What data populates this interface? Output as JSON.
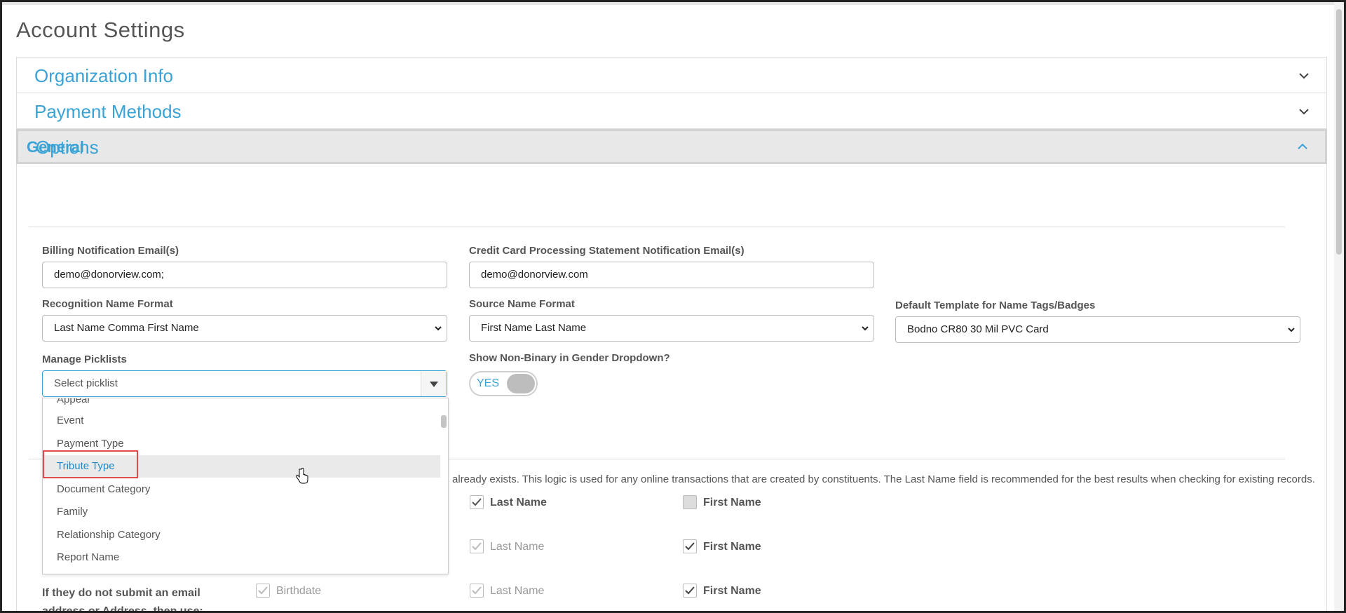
{
  "page_title": "Account Settings",
  "sections": [
    {
      "label": "Organization Info",
      "state": "collapsed"
    },
    {
      "label": "Payment Methods",
      "state": "collapsed"
    },
    {
      "label": "Options",
      "state": "expanded"
    }
  ],
  "general": {
    "title": "General",
    "billing": {
      "label": "Billing Notification Email(s)",
      "value": "demo@donorview.com;"
    },
    "cc_statement": {
      "label": "Credit Card Processing Statement Notification Email(s)",
      "value": "demo@donorview.com"
    },
    "recognition": {
      "label": "Recognition Name Format",
      "value": "Last Name Comma First Name"
    },
    "source": {
      "label": "Source Name Format",
      "value": "First Name Last Name"
    },
    "template": {
      "label": "Default Template for Name Tags/Badges",
      "value": "Bodno CR80 30 Mil PVC Card"
    },
    "picklists": {
      "label": "Manage Picklists",
      "placeholder": "Select picklist",
      "options": [
        "Appeal",
        "Event",
        "Payment Type",
        "Tribute Type",
        "Document Category",
        "Family",
        "Relationship Category",
        "Report Name"
      ],
      "highlighted": "Tribute Type"
    },
    "non_binary": {
      "label": "Show Non-Binary in Gender Dropdown?",
      "toggle_text": "YES"
    }
  },
  "matching": {
    "description": "already exists. This logic is used for any online transactions that are created by constituents. The Last Name field is recommended for the best results when checking for existing records.",
    "row1": {
      "last": "Last Name",
      "first": "First Name"
    },
    "row2": {
      "last": "Last Name",
      "first": "First Name"
    },
    "row3": {
      "label": "If they do not submit an email address or Address, then use:",
      "birthdate": "Birthdate",
      "last": "Last Name",
      "first": "First Name"
    }
  },
  "colors": {
    "accent": "#3aa3d6",
    "highlight_border": "#e24b4b"
  }
}
